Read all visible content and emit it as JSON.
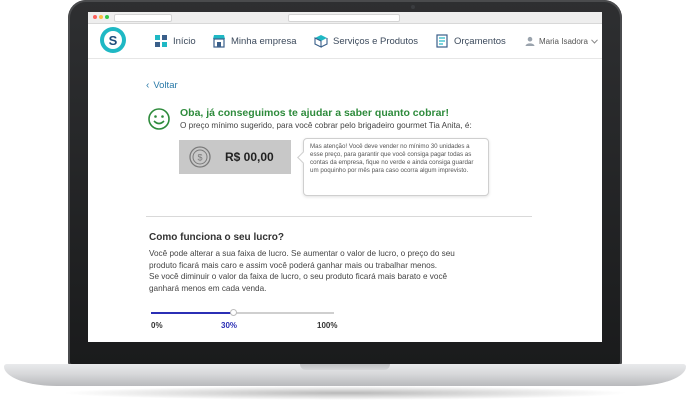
{
  "header": {
    "logo_letter": "S",
    "nav": [
      {
        "label": "Início",
        "icon": "dashboard-icon"
      },
      {
        "label": "Minha empresa",
        "icon": "store-icon"
      },
      {
        "label": "Serviços e Produtos",
        "icon": "boxes-icon"
      },
      {
        "label": "Orçamentos",
        "icon": "document-icon"
      }
    ],
    "user_name": "Maria Isadora"
  },
  "back_label": "Voltar",
  "result": {
    "headline": "Oba, já conseguimos te ajudar a saber quanto cobrar!",
    "subline": "O preço mínimo sugerido, para você cobrar pelo brigadeiro gourmet Tia Anita, é:",
    "price": "R$ 00,00",
    "tooltip": "Mas atenção! Você deve vender no mínimo 30 unidades a esse preço, para garantir que você consiga pagar todas as contas da empresa, fique no verde e ainda consiga guardar um poquinho por mês para caso ocorra algum imprevisto."
  },
  "profit": {
    "title": "Como funciona o seu lucro?",
    "body_1": "Você pode alterar a sua faixa de lucro. Se aumentar o valor de lucro, o preço do seu produto ficará mais caro e assim você poderá ganhar mais ou trabalhar menos.",
    "body_2": "Se você diminuir o valor da faixa de lucro, o seu produto ficará mais barato e você ganhará menos em cada venda.",
    "slider": {
      "min_label": "0%",
      "value_label": "30%",
      "max_label": "100%",
      "value": 0.45
    }
  },
  "colors": {
    "accent_teal": "#1fb8c4",
    "headline_green": "#2e8b3c",
    "slider_blue": "#2b2fb5",
    "link_blue": "#2a7aa8"
  }
}
